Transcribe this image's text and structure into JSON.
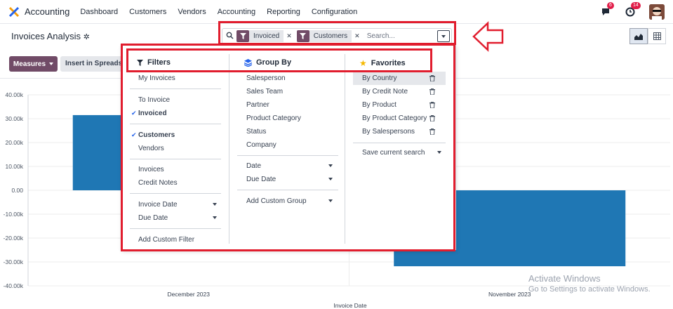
{
  "navbar": {
    "app_name": "Accounting",
    "menu": [
      "Dashboard",
      "Customers",
      "Vendors",
      "Accounting",
      "Reporting",
      "Configuration"
    ],
    "messages_count": "6",
    "activities_count": "14"
  },
  "control": {
    "title": "Invoices Analysis",
    "facets": [
      "Invoiced",
      "Customers"
    ],
    "search_placeholder": "Search..."
  },
  "toolbar": {
    "measures_label": "Measures",
    "insert_label": "Insert in Spreadsh"
  },
  "filters": {
    "header": "Filters",
    "items": [
      "My Invoices",
      "To Invoice",
      "Invoiced",
      "Customers",
      "Vendors",
      "Invoices",
      "Credit Notes",
      "Invoice Date",
      "Due Date",
      "Add Custom Filter"
    ]
  },
  "group_by": {
    "header": "Group By",
    "items": [
      "Salesperson",
      "Sales Team",
      "Partner",
      "Product Category",
      "Status",
      "Company",
      "Date",
      "Due Date",
      "Add Custom Group"
    ]
  },
  "favorites": {
    "header": "Favorites",
    "items": [
      "By Country",
      "By Credit Note",
      "By Product",
      "By Product Category",
      "By Salespersons"
    ],
    "save_label": "Save current search"
  },
  "chart_data": {
    "type": "bar",
    "categories": [
      "December 2023",
      "November 2023"
    ],
    "values": [
      31500,
      -31800
    ],
    "xlabel": "Invoice Date",
    "ylim": [
      -40000,
      40000
    ],
    "yticks": [
      "40.00k",
      "30.00k",
      "20.00k",
      "10.00k",
      "0.00",
      "-10.00k",
      "-20.00k",
      "-30.00k",
      "-40.00k"
    ],
    "color": "#1f77b4"
  },
  "watermark": {
    "line1": "Activate Windows",
    "line2": "Go to Settings to activate Windows."
  },
  "colors": {
    "accent": "#714b67",
    "highlight_box": "#e11d2e",
    "bar": "#1f77b4"
  }
}
